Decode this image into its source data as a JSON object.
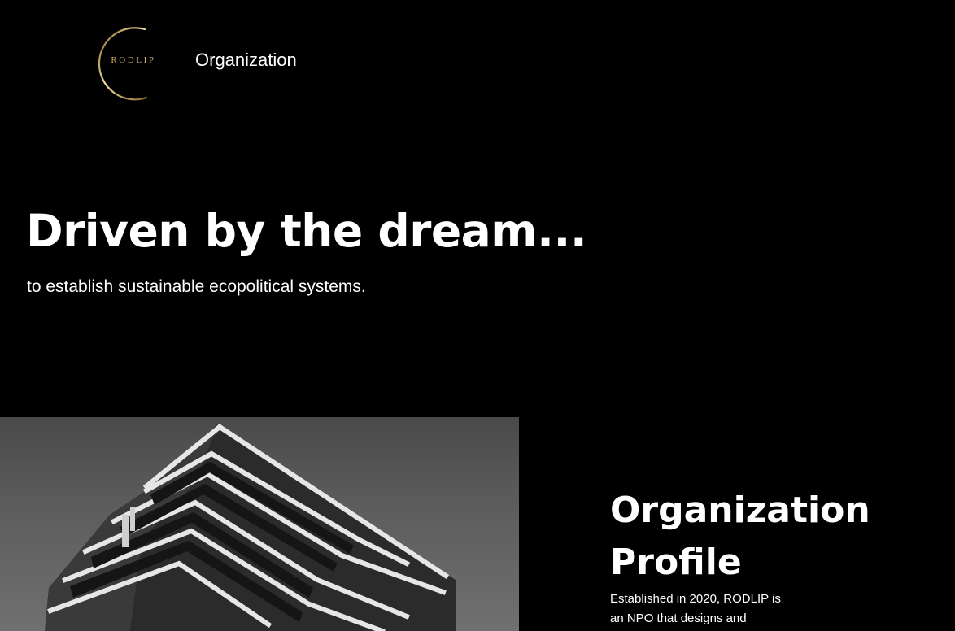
{
  "header": {
    "logo_text": "RODLIP",
    "nav_label": "Organization"
  },
  "hero": {
    "title": "Driven by the dream...",
    "subtitle": "to establish sustainable ecopolitical systems."
  },
  "profile": {
    "title_line1": "Organization",
    "title_line2": "Profile",
    "text_line1": "Established in 2020, RODLIP is",
    "text_line2": "an NPO that designs and"
  },
  "colors": {
    "background": "#000000",
    "text": "#ffffff",
    "logo_gold": "#cfa96a"
  }
}
